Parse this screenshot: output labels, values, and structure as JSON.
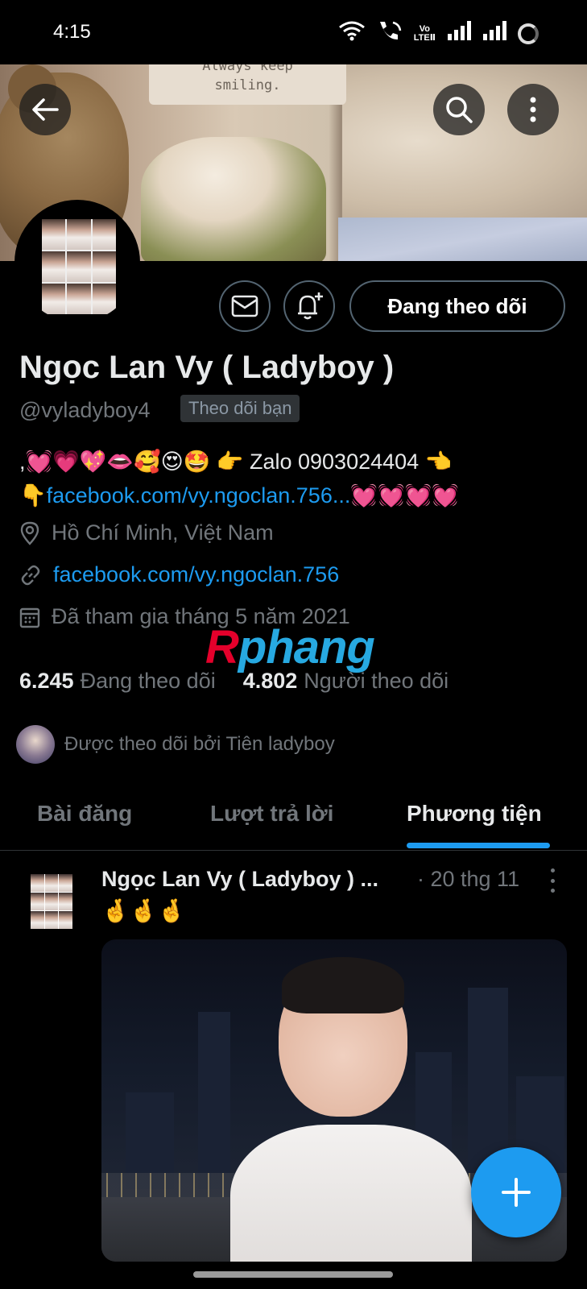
{
  "status_bar": {
    "time": "4:15",
    "icons": [
      "wifi-icon",
      "wifi-call-icon",
      "volte-icon",
      "signal-icon",
      "signal-icon",
      "battery-icon"
    ],
    "volte_top": "Vo",
    "volte_bottom": "LTEⅡ"
  },
  "banner": {
    "note_line1": "Always keep",
    "note_line2": "smiling."
  },
  "profile": {
    "name": "Ngọc Lan Vy ( Ladyboy )",
    "handle": "@vyladyboy4",
    "follows_you": "Theo dõi bạn",
    "follow_button": "Đang theo dõi",
    "bio_line1": ",💓💗💖👄🥰😍🤩 👉 Zalo 0903024404 👈",
    "bio_line2_prefix": "👇",
    "bio_line2_link": "facebook.com/vy.ngoclan.756...",
    "bio_line2_suffix": "💓💓💓💓",
    "location": "Hồ Chí Minh, Việt Nam",
    "website": "facebook.com/vy.ngoclan.756",
    "joined": "Đã tham gia tháng 5 năm 2021",
    "following_count": "6.245",
    "following_label": "Đang theo dõi",
    "followers_count": "4.802",
    "followers_label": "Người theo dõi",
    "followed_by": "Được theo dõi bởi Tiên ladyboy"
  },
  "watermark": {
    "part1": "R",
    "part2": "phang"
  },
  "tabs": [
    {
      "label": "Bài đăng",
      "active": false
    },
    {
      "label": "Lượt trả lời",
      "active": false
    },
    {
      "label": "Phương tiện",
      "active": true
    }
  ],
  "post": {
    "author": "Ngọc Lan Vy ( Ladyboy ) ...",
    "date": "· 20 thg 11",
    "text": "🤞🤞🤞"
  },
  "colors": {
    "accent": "#1d9bf0",
    "background": "#000000",
    "secondary_text": "#71767b",
    "primary_text": "#e7e9ea"
  }
}
